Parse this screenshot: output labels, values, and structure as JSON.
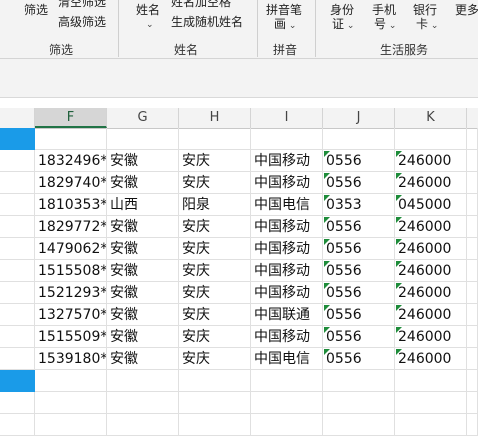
{
  "ribbon": {
    "groups": [
      {
        "label": "筛选",
        "buttons": [
          "筛选",
          "清空筛选",
          "高级筛选"
        ]
      },
      {
        "label": "姓名",
        "buttons": [
          "姓名",
          "姓名加空格",
          "生成随机姓名"
        ]
      },
      {
        "label": "拼音",
        "buttons": [
          "拼音笔",
          "画"
        ]
      },
      {
        "label": "生活服务",
        "buttons": [
          "身份",
          "证",
          "手机",
          "号",
          "银行",
          "卡",
          "更多"
        ]
      }
    ]
  },
  "spreadsheet": {
    "columns": [
      "F",
      "G",
      "H",
      "I",
      "J",
      "K"
    ],
    "active_column": "F",
    "rows": [
      [
        "1832496*",
        "安徽",
        "安庆",
        "中国移动",
        "0556",
        "246000"
      ],
      [
        "1829740*",
        "安徽",
        "安庆",
        "中国移动",
        "0556",
        "246000"
      ],
      [
        "1810353*",
        "山西",
        "阳泉",
        "中国电信",
        "0353",
        "045000"
      ],
      [
        "1829772*",
        "安徽",
        "安庆",
        "中国移动",
        "0556",
        "246000"
      ],
      [
        "1479062*",
        "安徽",
        "安庆",
        "中国移动",
        "0556",
        "246000"
      ],
      [
        "1515508*",
        "安徽",
        "安庆",
        "中国移动",
        "0556",
        "246000"
      ],
      [
        "1521293*",
        "安徽",
        "安庆",
        "中国移动",
        "0556",
        "246000"
      ],
      [
        "1327570*",
        "安徽",
        "安庆",
        "中国联通",
        "0556",
        "246000"
      ],
      [
        "1515509*",
        "安徽",
        "安庆",
        "中国移动",
        "0556",
        "246000"
      ],
      [
        "1539180*",
        "安徽",
        "安庆",
        "中国电信",
        "0556",
        "246000"
      ]
    ]
  },
  "colors": {
    "selection": "#1a9be8",
    "text_indicator": "#1e8c3a"
  }
}
